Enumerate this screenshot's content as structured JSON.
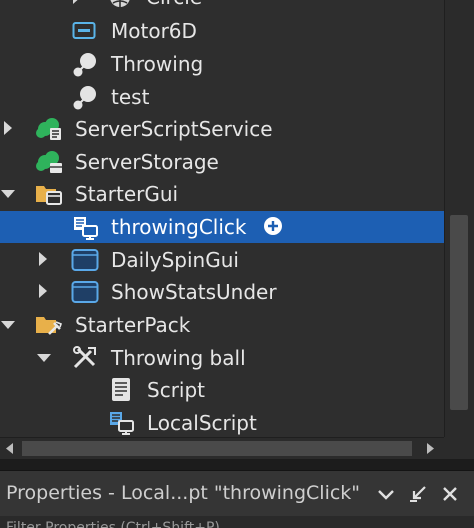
{
  "explorer": {
    "items": [
      {
        "label": "Circle",
        "icon": "mesh-part-icon",
        "expander": "collapsed"
      },
      {
        "label": "Motor6D",
        "icon": "motor6d-icon",
        "expander": "none"
      },
      {
        "label": "Throwing",
        "icon": "animation-icon",
        "expander": "none"
      },
      {
        "label": "test",
        "icon": "animation-icon",
        "expander": "none"
      },
      {
        "label": "ServerScriptService",
        "icon": "server-script-service-icon",
        "expander": "collapsed"
      },
      {
        "label": "ServerStorage",
        "icon": "server-storage-icon",
        "expander": "none"
      },
      {
        "label": "StarterGui",
        "icon": "starter-gui-icon",
        "expander": "expanded"
      },
      {
        "label": "throwingClick",
        "icon": "local-script-icon",
        "expander": "none",
        "selected": true
      },
      {
        "label": "DailySpinGui",
        "icon": "screen-gui-icon",
        "expander": "collapsed"
      },
      {
        "label": "ShowStatsUnder",
        "icon": "screen-gui-icon",
        "expander": "collapsed"
      },
      {
        "label": "StarterPack",
        "icon": "starter-pack-icon",
        "expander": "expanded"
      },
      {
        "label": "Throwing ball",
        "icon": "tool-icon",
        "expander": "expanded"
      },
      {
        "label": "Script",
        "icon": "script-icon",
        "expander": "none"
      },
      {
        "label": "LocalScript",
        "icon": "local-script-icon",
        "expander": "none"
      }
    ],
    "add_icon": "plus-circle-icon"
  },
  "properties": {
    "title": "Properties - Local...pt \"throwingClick\"",
    "dropdown_icon": "chevron-down-icon",
    "undock_icon": "undock-icon",
    "close_icon": "close-icon",
    "filter_partial": "Filter Properties (Ctrl+Shift+P)"
  },
  "colors": {
    "background": "#2e2e2e",
    "selection": "#1d5fb3",
    "text": "#e6e6e6"
  }
}
